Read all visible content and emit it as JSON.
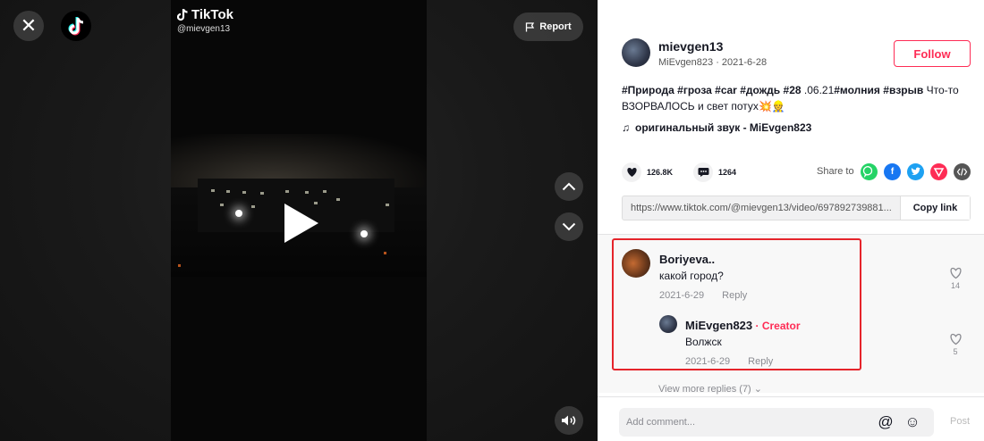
{
  "video": {
    "brand_name": "TikTok",
    "handle": "@mievgen13",
    "report_label": "Report",
    "close_glyph": "✕"
  },
  "author": {
    "username": "mievgen13",
    "nickname_date": "MiEvgen823 · 2021-6-28",
    "follow_label": "Follow"
  },
  "description": {
    "tags": [
      "#Природа",
      "#гроза",
      "#car",
      "#дождь",
      "#28"
    ],
    "middle": " .06.21",
    "tags2": [
      "#молния",
      "#взрыв"
    ],
    "text": " Что-то ВЗОРВАЛОСЬ и свет потух",
    "emojis": "💥👷"
  },
  "music": {
    "note_glyph": "♫",
    "title": "оригинальный звук - MiEvgen823"
  },
  "stats": {
    "likes": "126.8K",
    "comments": "1264",
    "share_label": "Share to"
  },
  "share_targets": [
    {
      "name": "whatsapp-icon",
      "color": "#25d366"
    },
    {
      "name": "facebook-icon",
      "color": "#1877f2"
    },
    {
      "name": "twitter-icon",
      "color": "#1da1f2"
    },
    {
      "name": "send-icon",
      "color": "#fe2c55"
    },
    {
      "name": "embed-icon",
      "color": "#555555"
    }
  ],
  "link": {
    "url": "https://www.tiktok.com/@mievgen13/video/697892739881...",
    "copy_label": "Copy link"
  },
  "comments": [
    {
      "name": "Boriyeva..",
      "text": "какой город?",
      "date": "2021-6-29",
      "reply_label": "Reply",
      "likes": "14",
      "reply": {
        "name": "MiEvgen823",
        "separator": " · ",
        "badge": "Creator",
        "text": "Волжск",
        "date": "2021-6-29",
        "reply_label": "Reply",
        "likes": "5"
      }
    }
  ],
  "view_more": "View more replies (7) ⌄",
  "composer": {
    "placeholder": "Add comment...",
    "post_label": "Post"
  },
  "colors": {
    "accent": "#fe2c55",
    "highlight_border": "#e5242b"
  }
}
